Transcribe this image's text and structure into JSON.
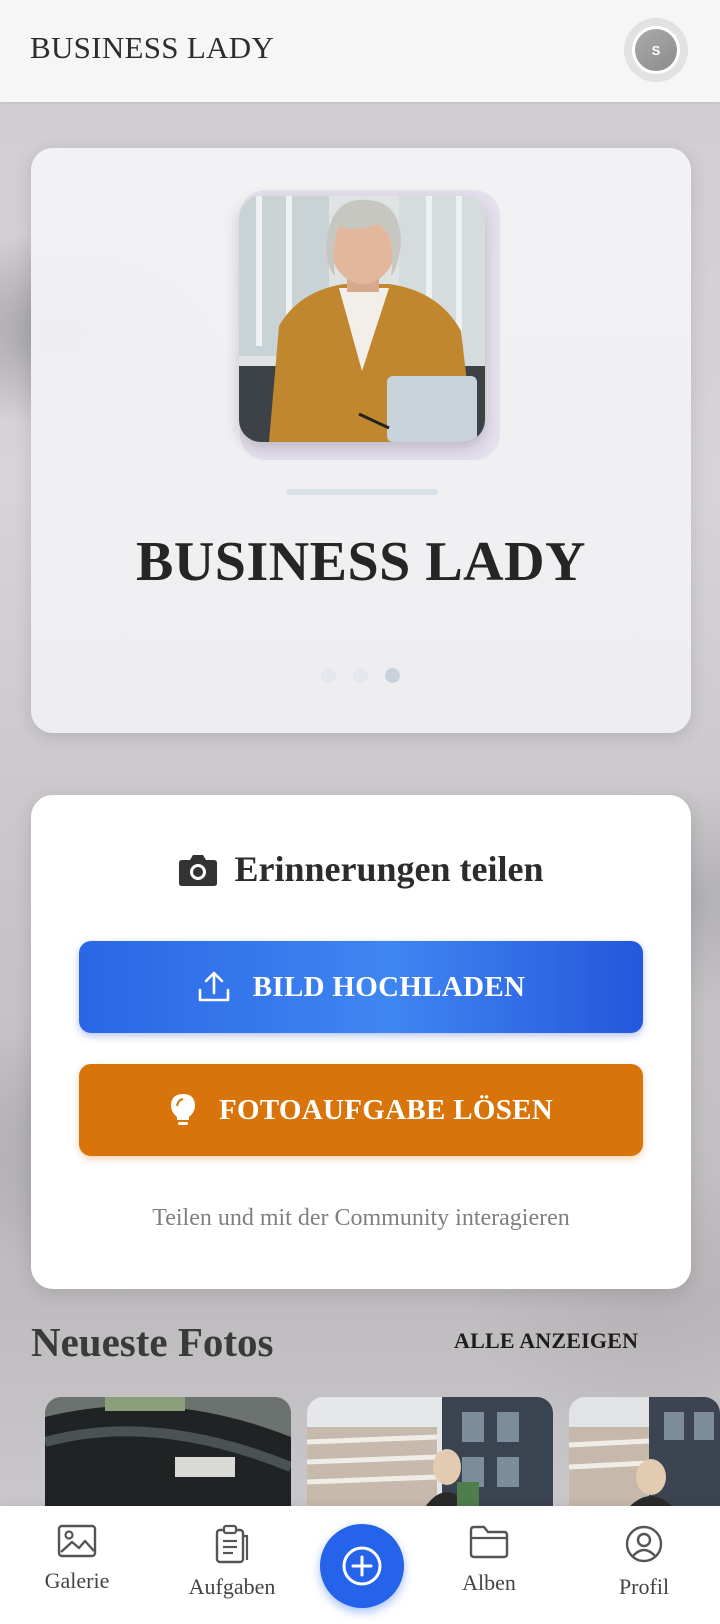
{
  "header": {
    "title": "BUSINESS LADY",
    "avatar_initial": "S"
  },
  "hero": {
    "title": "BUSINESS LADY",
    "slide_count": 3,
    "active_slide": 2
  },
  "share": {
    "title": "Erinnerungen teilen",
    "title_icon": "camera-icon",
    "upload_button": "BILD HOCHLADEN",
    "upload_icon": "upload-icon",
    "task_button": "FOTOAUFGABE LÖSEN",
    "task_icon": "lightbulb-icon",
    "caption": "Teilen und mit der Community interagieren"
  },
  "recent": {
    "title": "Neueste Fotos",
    "see_all": "ALLE ANZEIGEN"
  },
  "nav": {
    "items": [
      {
        "label": "Galerie",
        "icon": "image-icon"
      },
      {
        "label": "Aufgaben",
        "icon": "clipboard-icon"
      },
      {
        "label": "Alben",
        "icon": "folder-icon"
      },
      {
        "label": "Profil",
        "icon": "user-circle-icon"
      }
    ],
    "fab_icon": "plus-circle-icon"
  },
  "colors": {
    "upload_button": "#2a66e6",
    "task_button": "#d9740a",
    "fab": "#2563eb"
  }
}
